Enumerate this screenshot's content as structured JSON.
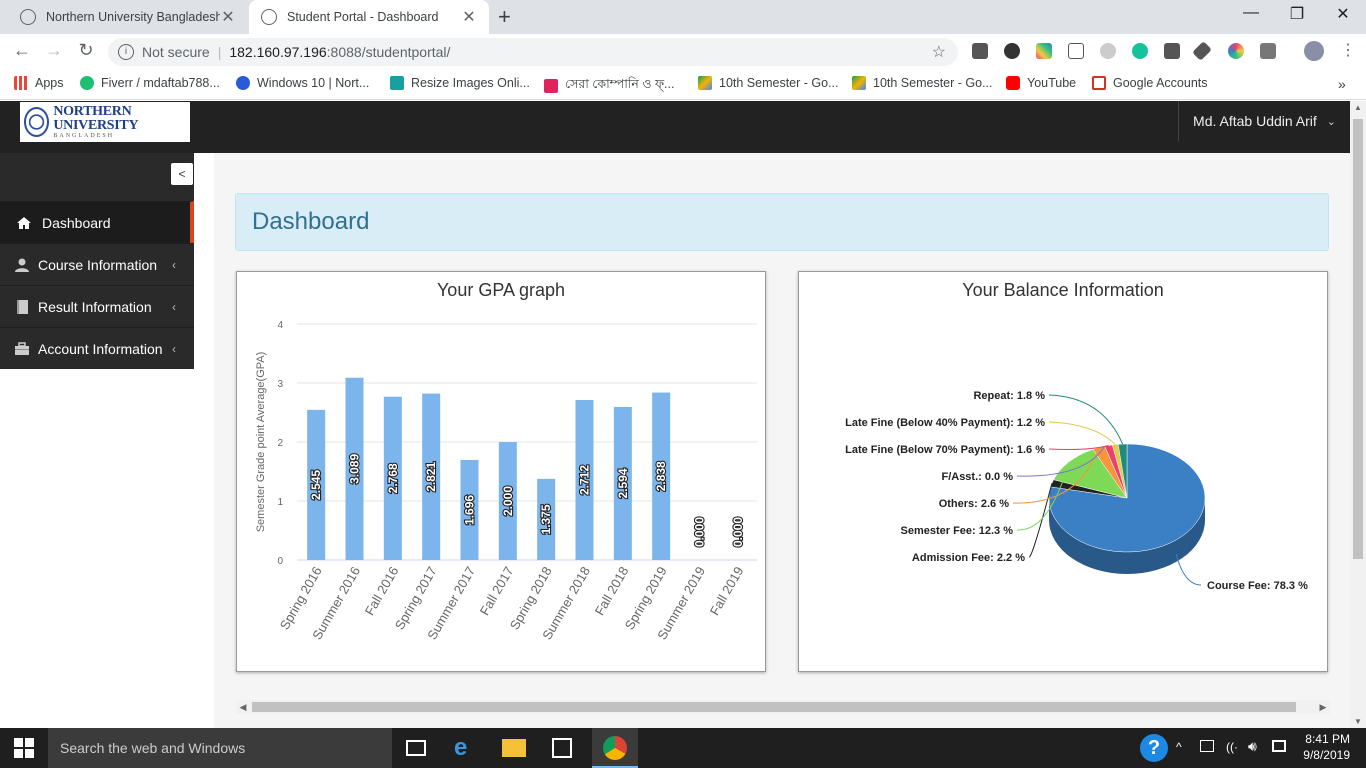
{
  "browser": {
    "tabs": [
      {
        "title": "Northern University Bangladesh",
        "active": false
      },
      {
        "title": "Student Portal - Dashboard",
        "active": true
      }
    ],
    "new_tab": "+",
    "window_controls": {
      "minimize": "—",
      "maximize": "❐",
      "close": "✕"
    },
    "url": {
      "security": "Not secure",
      "host": "182.160.97.196",
      "rest": ":8088/studentportal/"
    },
    "bookmarks": [
      {
        "label": "Apps",
        "color": "#e8453c"
      },
      {
        "label": "Fiverr / mdaftab788...",
        "color": "#1dbf73"
      },
      {
        "label": "Windows 10 | Nort...",
        "color": "#2a5bd7"
      },
      {
        "label": "Resize Images Onli...",
        "color": "#18a0a0"
      },
      {
        "label": "সেরা কোম্পানি ও ফ্...",
        "color": "#e0245e"
      },
      {
        "label": "10th Semester - Go...",
        "color": "#0f9d58"
      },
      {
        "label": "10th Semester - Go...",
        "color": "#0f9d58"
      },
      {
        "label": "YouTube",
        "color": "#ff0000"
      },
      {
        "label": "Google Accounts",
        "color": "#d93025"
      }
    ],
    "more_bookmarks": "»"
  },
  "header": {
    "logo_text": "NORTHERN UNIVERSITY",
    "logo_sub": "BANGLADESH",
    "user_name": "Md. Aftab Uddin Arif"
  },
  "sidebar": {
    "items": [
      {
        "label": "Dashboard",
        "icon": "home-icon",
        "active": true
      },
      {
        "label": "Course Information",
        "icon": "user-icon",
        "active": false
      },
      {
        "label": "Result Information",
        "icon": "book-icon",
        "active": false
      },
      {
        "label": "Account Information",
        "icon": "briefcase-icon",
        "active": false
      }
    ]
  },
  "main": {
    "title": "Dashboard",
    "gpa_panel_title": "Your GPA graph",
    "balance_panel_title": "Your Balance Information"
  },
  "chart_data": [
    {
      "type": "bar",
      "title": "Your GPA graph",
      "ylabel": "Semester Grade point Average(GPA)",
      "xlabel": "",
      "ylim": [
        0,
        4
      ],
      "yticks": [
        0,
        1,
        2,
        3,
        4
      ],
      "grid": true,
      "bar_color": "#7cb5ec",
      "categories": [
        "Spring 2016",
        "Summer 2016",
        "Fall 2016",
        "Spring 2017",
        "Summer 2017",
        "Fall 2017",
        "Spring 2018",
        "Summer 2018",
        "Fall 2018",
        "Spring 2019",
        "Summer 2019",
        "Fall 2019"
      ],
      "values": [
        2.545,
        3.089,
        2.768,
        2.821,
        1.696,
        2.0,
        1.375,
        2.712,
        2.594,
        2.838,
        0.0,
        0.0
      ],
      "value_labels": [
        "2.545",
        "3.089",
        "2.768",
        "2.821",
        "1.696",
        "2.000",
        "1.375",
        "2.712",
        "2.594",
        "2.838",
        "0.000",
        "0.000"
      ]
    },
    {
      "type": "pie",
      "title": "Your Balance Information",
      "style": "3d",
      "slices": [
        {
          "name": "Course Fee",
          "value": 78.3,
          "label": "Course Fee: 78.3 %",
          "color": "#3b7fc4"
        },
        {
          "name": "Admission Fee",
          "value": 2.2,
          "label": "Admission Fee: 2.2 %",
          "color": "#222222"
        },
        {
          "name": "Semester Fee",
          "value": 12.3,
          "label": "Semester Fee: 12.3 %",
          "color": "#7ed957"
        },
        {
          "name": "Others",
          "value": 2.6,
          "label": "Others: 2.6 %",
          "color": "#f7943c"
        },
        {
          "name": "F/Asst.",
          "value": 0.0,
          "label": "F/Asst.: 0.0 %",
          "color": "#7b70d6"
        },
        {
          "name": "Late Fine (Below 70% Payment)",
          "value": 1.6,
          "label": "Late Fine (Below 70% Payment): 1.6 %",
          "color": "#e8426d"
        },
        {
          "name": "Late Fine (Below 40% Payment)",
          "value": 1.2,
          "label": "Late Fine (Below 40% Payment): 1.2 %",
          "color": "#e4c94a"
        },
        {
          "name": "Repeat",
          "value": 1.8,
          "label": "Repeat: 1.8 %",
          "color": "#1f8c7a"
        }
      ]
    }
  ],
  "taskbar": {
    "search_placeholder": "Search the web and Windows",
    "time": "8:41 PM",
    "date": "9/8/2019"
  }
}
